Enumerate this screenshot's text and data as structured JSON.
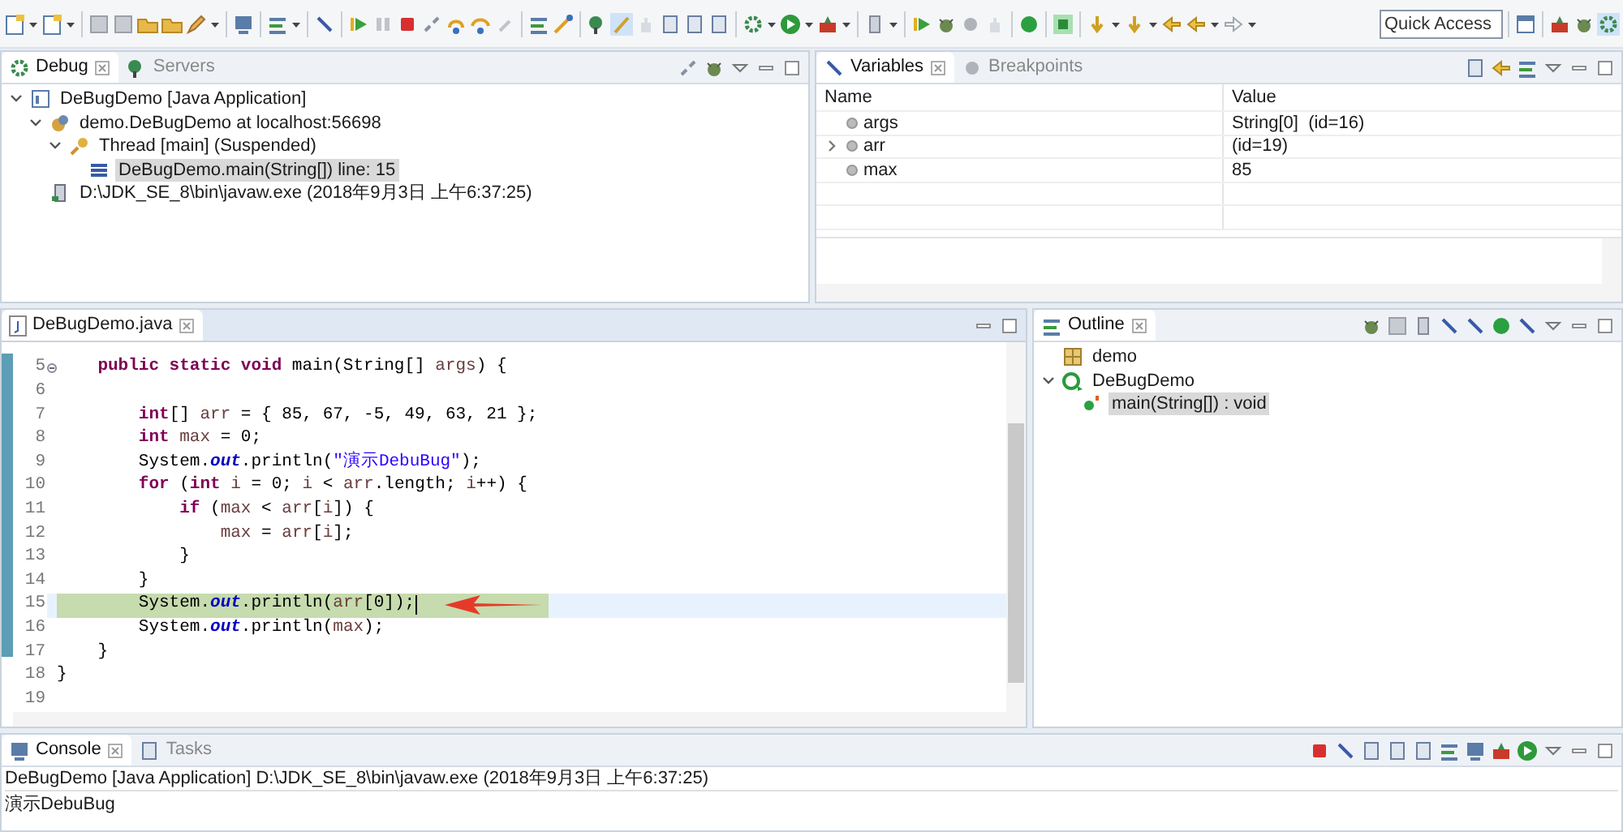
{
  "toolbar": {
    "quick_access": {
      "placeholder": "Quick Access"
    }
  },
  "debug_view": {
    "tabs": [
      {
        "label": "Debug",
        "selected": true
      },
      {
        "label": "Servers",
        "selected": false
      }
    ],
    "tree": [
      {
        "kind": "launch",
        "label": "DeBugDemo [Java Application]",
        "expanded": true,
        "selected": false,
        "children": [
          {
            "kind": "target",
            "label": "demo.DeBugDemo at localhost:56698",
            "expanded": true,
            "selected": false,
            "children": [
              {
                "kind": "thread",
                "label": "Thread [main] (Suspended)",
                "expanded": true,
                "selected": false,
                "children": [
                  {
                    "kind": "frame",
                    "label": "DeBugDemo.main(String[]) line: 15",
                    "selected": true
                  }
                ]
              }
            ]
          },
          {
            "kind": "process",
            "label": "D:\\JDK_SE_8\\bin\\javaw.exe (2018年9月3日 上午6:37:25)",
            "selected": false
          }
        ]
      }
    ]
  },
  "variables_view": {
    "tabs": [
      {
        "label": "Variables",
        "selected": true
      },
      {
        "label": "Breakpoints",
        "selected": false
      }
    ],
    "columns": [
      "Name",
      "Value"
    ],
    "rows": [
      {
        "name": "args",
        "value": "String[0]  (id=16)",
        "expandable": false
      },
      {
        "name": "arr",
        "value": "(id=19)",
        "expandable": true
      },
      {
        "name": "max",
        "value": "85",
        "expandable": false
      }
    ]
  },
  "editor": {
    "tab": "DeBugDemo.java",
    "lines": [
      {
        "number": "5",
        "current": false,
        "foldable": true,
        "tokens": [
          {
            "kind": "keyword",
            "text": "    public static void"
          },
          {
            "kind": "plain",
            "text": " main(String[] "
          },
          {
            "kind": "variable",
            "text": "args"
          },
          {
            "kind": "plain",
            "text": ") {"
          }
        ]
      },
      {
        "number": "6",
        "current": false,
        "foldable": false
      },
      {
        "number": "7",
        "current": false,
        "foldable": false,
        "tokens": [
          {
            "kind": "keyword",
            "text": "        int"
          },
          {
            "kind": "plain",
            "text": "[] "
          },
          {
            "kind": "variable",
            "text": "arr"
          },
          {
            "kind": "plain",
            "text": " = { 85, 67, -5, 49, 63, 21 };"
          }
        ]
      },
      {
        "number": "8",
        "current": false,
        "foldable": false,
        "tokens": [
          {
            "kind": "keyword",
            "text": "        int"
          },
          {
            "kind": "variable",
            "text": " max"
          },
          {
            "kind": "plain",
            "text": " = 0;"
          }
        ]
      },
      {
        "number": "9",
        "current": false,
        "foldable": false,
        "tokens": [
          {
            "kind": "plain",
            "text": "        System."
          },
          {
            "kind": "field",
            "text": "out"
          },
          {
            "kind": "plain",
            "text": ".println("
          },
          {
            "kind": "string",
            "text": "\"演示DebuBug\""
          },
          {
            "kind": "plain",
            "text": ");"
          }
        ]
      },
      {
        "number": "10",
        "current": false,
        "foldable": false,
        "tokens": [
          {
            "kind": "keyword",
            "text": "        for"
          },
          {
            "kind": "plain",
            "text": " ("
          },
          {
            "kind": "keyword",
            "text": "int"
          },
          {
            "kind": "variable",
            "text": " i"
          },
          {
            "kind": "plain",
            "text": " = 0; "
          },
          {
            "kind": "variable",
            "text": "i"
          },
          {
            "kind": "plain",
            "text": " < "
          },
          {
            "kind": "variable",
            "text": "arr"
          },
          {
            "kind": "plain",
            "text": ".length; "
          },
          {
            "kind": "variable",
            "text": "i"
          },
          {
            "kind": "plain",
            "text": "++) {"
          }
        ]
      },
      {
        "number": "11",
        "current": false,
        "foldable": false,
        "tokens": [
          {
            "kind": "keyword",
            "text": "            if"
          },
          {
            "kind": "plain",
            "text": " ("
          },
          {
            "kind": "variable",
            "text": "max"
          },
          {
            "kind": "plain",
            "text": " < "
          },
          {
            "kind": "variable",
            "text": "arr"
          },
          {
            "kind": "plain",
            "text": "["
          },
          {
            "kind": "variable",
            "text": "i"
          },
          {
            "kind": "plain",
            "text": "]) {"
          }
        ]
      },
      {
        "number": "12",
        "current": false,
        "foldable": false,
        "tokens": [
          {
            "kind": "variable",
            "text": "                max"
          },
          {
            "kind": "plain",
            "text": " = "
          },
          {
            "kind": "variable",
            "text": "arr"
          },
          {
            "kind": "plain",
            "text": "["
          },
          {
            "kind": "variable",
            "text": "i"
          },
          {
            "kind": "plain",
            "text": "];"
          }
        ]
      },
      {
        "number": "13",
        "current": false,
        "foldable": false,
        "tokens": [
          {
            "kind": "plain",
            "text": "            }"
          }
        ]
      },
      {
        "number": "14",
        "current": false,
        "foldable": false,
        "tokens": [
          {
            "kind": "plain",
            "text": "        }"
          }
        ]
      },
      {
        "number": "15",
        "current": true,
        "foldable": false,
        "tokens": [
          {
            "kind": "plain",
            "text": "        System."
          },
          {
            "kind": "field",
            "text": "out"
          },
          {
            "kind": "plain",
            "text": ".println("
          },
          {
            "kind": "variable",
            "text": "arr"
          },
          {
            "kind": "plain",
            "text": "[0]);"
          }
        ]
      },
      {
        "number": "16",
        "current": false,
        "foldable": false,
        "tokens": [
          {
            "kind": "plain",
            "text": "        System."
          },
          {
            "kind": "field",
            "text": "out"
          },
          {
            "kind": "plain",
            "text": ".println("
          },
          {
            "kind": "variable",
            "text": "max"
          },
          {
            "kind": "plain",
            "text": ");"
          }
        ]
      },
      {
        "number": "17",
        "current": false,
        "foldable": false,
        "tokens": [
          {
            "kind": "plain",
            "text": "    }"
          }
        ]
      },
      {
        "number": "18",
        "current": false,
        "foldable": false,
        "tokens": [
          {
            "kind": "plain",
            "text": "}"
          }
        ]
      },
      {
        "number": "19",
        "current": false,
        "foldable": false
      }
    ]
  },
  "outline_view": {
    "tab": "Outline",
    "tree": [
      {
        "kind": "package",
        "label": "demo",
        "selected": false
      },
      {
        "kind": "class",
        "label": "DeBugDemo",
        "expanded": true,
        "selected": false,
        "children": [
          {
            "kind": "method",
            "label": "main(String[]) : void",
            "selected": true
          }
        ]
      }
    ]
  },
  "console_view": {
    "tabs": [
      {
        "label": "Console",
        "selected": true
      },
      {
        "label": "Tasks",
        "selected": false
      }
    ],
    "description": "DeBugDemo [Java Application] D:\\JDK_SE_8\\bin\\javaw.exe (2018年9月3日 上午6:37:25)",
    "output": [
      "演示DebuBug"
    ]
  }
}
